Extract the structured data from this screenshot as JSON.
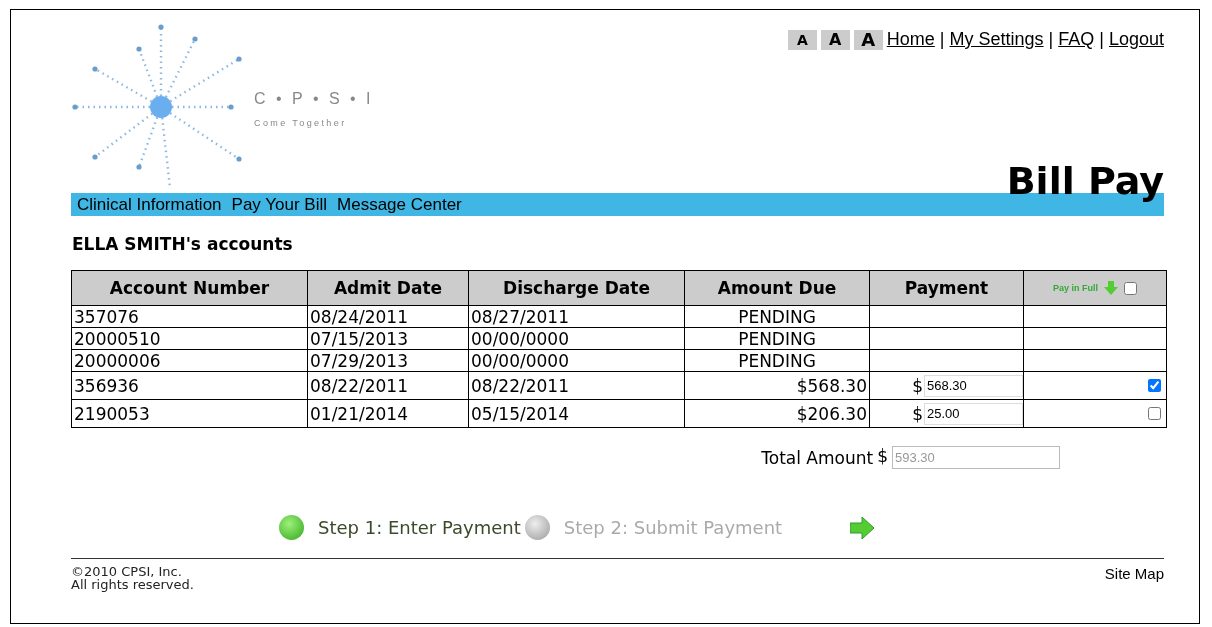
{
  "logo": {
    "name": "C • P • S • I",
    "tagline": "Come Together"
  },
  "font_sizes": [
    "A",
    "A",
    "A"
  ],
  "top_links": [
    "Home",
    "My Settings",
    "FAQ",
    "Logout"
  ],
  "link_separators": [
    "|",
    "|",
    "|"
  ],
  "page_title": "Bill Pay",
  "nav": [
    "Clinical Information",
    "Pay Your Bill",
    "Message Center"
  ],
  "accounts_title": "ELLA SMITH's accounts",
  "table": {
    "columns": [
      "Account Number",
      "Admit Date",
      "Discharge Date",
      "Amount Due",
      "Payment"
    ],
    "pay_in_full": {
      "label": "Pay in Full",
      "checked": false
    },
    "rows": [
      {
        "account": "357076",
        "admit": "08/24/2011",
        "discharge": "08/27/2011",
        "amount_due": "PENDING",
        "kind": "pending"
      },
      {
        "account": "20000510",
        "admit": "07/15/2013",
        "discharge": "00/00/0000",
        "amount_due": "PENDING",
        "kind": "pending"
      },
      {
        "account": "20000006",
        "admit": "07/29/2013",
        "discharge": "00/00/0000",
        "amount_due": "PENDING",
        "kind": "pending"
      },
      {
        "account": "356936",
        "admit": "08/22/2011",
        "discharge": "08/22/2011",
        "amount_due": "$568.30",
        "kind": "due",
        "currency": "$",
        "payment": "568.30",
        "checked": true
      },
      {
        "account": "2190053",
        "admit": "01/21/2014",
        "discharge": "05/15/2014",
        "amount_due": "$206.30",
        "kind": "due",
        "currency": "$",
        "payment": "25.00",
        "checked": false
      }
    ]
  },
  "total": {
    "label": "Total Amount",
    "currency": "$",
    "value": "593.30",
    "disabled": true
  },
  "steps": [
    {
      "label": "Step 1: Enter Payment",
      "selected": true
    },
    {
      "label": "Step 2: Submit Payment",
      "selected": false
    }
  ],
  "footer": {
    "copyright": "©2010 CPSI, Inc.",
    "rights": "All rights reserved.",
    "site_map": "Site Map"
  }
}
